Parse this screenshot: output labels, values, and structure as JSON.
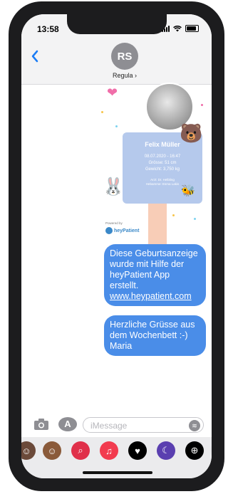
{
  "status_bar": {
    "time": "13:58"
  },
  "header": {
    "avatar_initials": "RS",
    "contact_name": "Regula ›",
    "back_icon": "chevron-left-icon"
  },
  "card": {
    "name": "Felix Müller",
    "datetime": "08.07.2020 - 16:47",
    "size": "Grösse: 51 cm",
    "weight": "Gewicht: 3,750 kg",
    "doctor": "Arzt: Dr. Helbling",
    "midwife": "Hebamme: Esma Lakis",
    "powered_by": "Powered by",
    "logo_text": "heyPatient"
  },
  "messages": [
    {
      "text": "Diese Geburtsanzeige wurde mit Hilfe der heyPatient App erstellt.",
      "link": "www.heypatient.com"
    },
    {
      "text": "Herzliche Grüsse aus dem Wochenbett :-) Maria"
    }
  ],
  "input": {
    "placeholder": "iMessage"
  },
  "app_tray": [
    "memoji-icon",
    "memoji-icon",
    "image-search-icon",
    "music-icon",
    "heart-icon",
    "digital-touch-icon",
    "shortcut-icon",
    "more-icon"
  ]
}
